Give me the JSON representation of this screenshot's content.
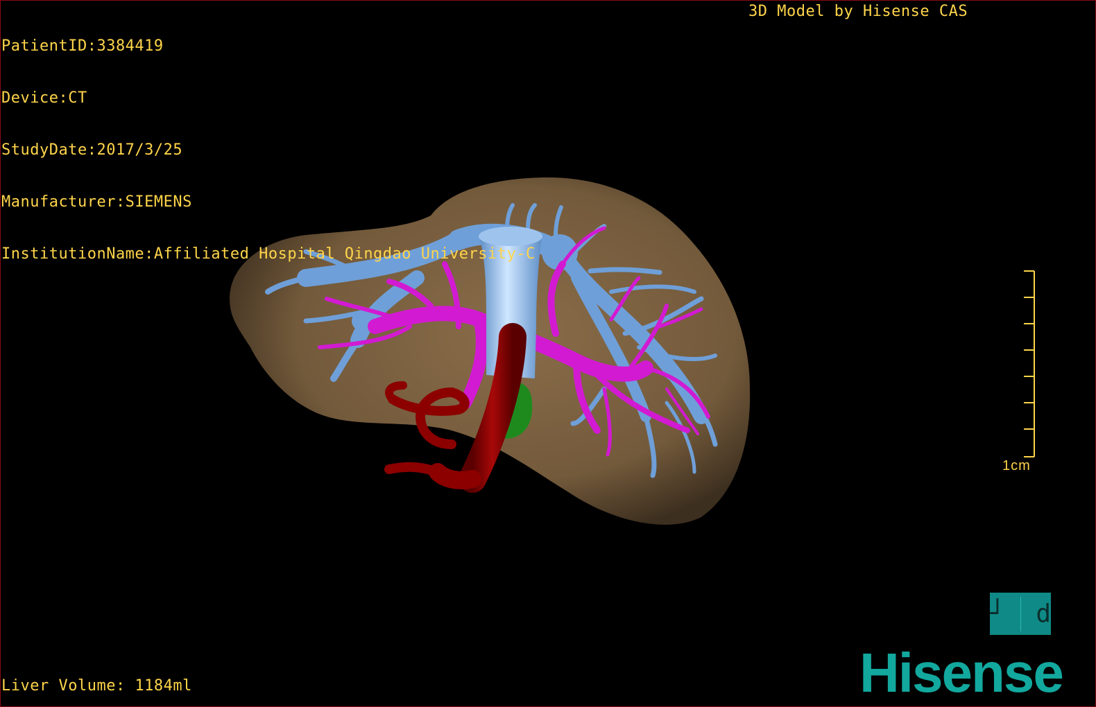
{
  "header": {
    "patient_id": "PatientID:3384419",
    "device": "Device:CT",
    "study_date": "StudyDate:2017/3/25",
    "manufacturer": "Manufacturer:SIEMENS",
    "institution": "InstitutionName:Affiliated Hospital Qingdao University-C",
    "credit": "3D Model by Hisense CAS"
  },
  "footer": {
    "liver_volume": "Liver Volume: 1184ml"
  },
  "scale": {
    "label": "1cm"
  },
  "orientation": {
    "left_glyph": "┘",
    "right_glyph": "d"
  },
  "brand": {
    "name": "Hisense",
    "color": "#12a89e"
  },
  "colors": {
    "overlay_text": "#ffd54a",
    "liver": "#7a6040",
    "hepatic_vein": "#6f9fd8",
    "portal_vein": "#d21ad2",
    "artery": "#8c0000",
    "gallbladder": "#1e8a1e"
  }
}
